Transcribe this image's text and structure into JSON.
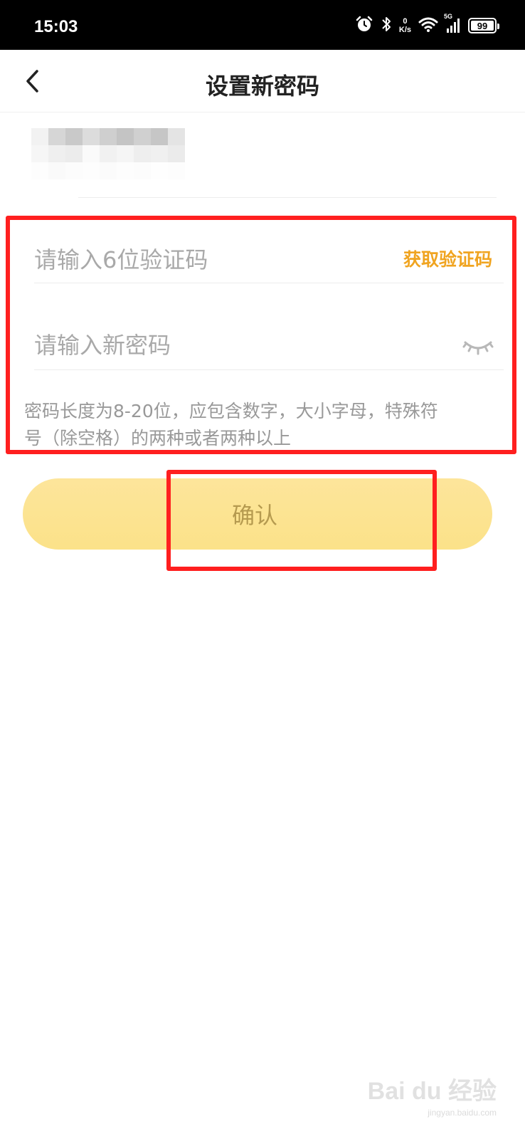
{
  "status_bar": {
    "time": "15:03",
    "net_speed_value": "0",
    "net_speed_unit": "K/s",
    "network_type": "5G",
    "battery": "99",
    "icons": [
      "alarm-icon",
      "bluetooth-icon",
      "wifi-icon",
      "signal-icon",
      "battery-icon"
    ]
  },
  "nav": {
    "back_icon": "back-arrow-icon",
    "title": "设置新密码"
  },
  "phone": {
    "masked": true
  },
  "form": {
    "code_placeholder": "请输入6位验证码",
    "get_code_label": "获取验证码",
    "password_placeholder": "请输入新密码",
    "eye_icon": "eye-closed-icon",
    "hint_line1": "密码长度为8-20位，应包含数字，大小字母，特殊符",
    "hint_line2": "号（除空格）的两种或者两种以上"
  },
  "confirm": {
    "label": "确认"
  },
  "colors": {
    "accent": "#f0a420",
    "button_bg": "#fde59b",
    "button_text": "#b59a4f",
    "highlight": "#ff1f1f"
  },
  "watermark": {
    "text": "Bai du 经验",
    "url": "jingyan.baidu.com"
  }
}
